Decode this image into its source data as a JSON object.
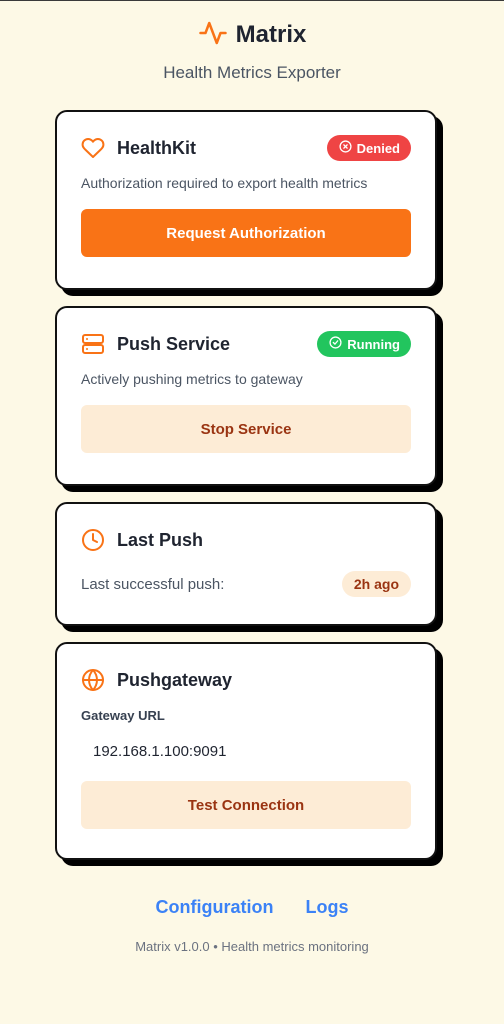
{
  "app": {
    "name": "Matrix",
    "subtitle": "Health Metrics Exporter",
    "logo_icon": "activity-icon",
    "accent_color": "#f97316"
  },
  "healthkit": {
    "title": "HealthKit",
    "icon": "heart-icon",
    "status_label": "Denied",
    "status_icon": "x-circle-icon",
    "status_color": "#ef4444",
    "description": "Authorization required to export health metrics",
    "button_label": "Request Authorization"
  },
  "push_service": {
    "title": "Push Service",
    "icon": "server-icon",
    "status_label": "Running",
    "status_icon": "check-circle-icon",
    "status_color": "#22c55e",
    "description": "Actively pushing metrics to gateway",
    "button_label": "Stop Service"
  },
  "last_push": {
    "title": "Last Push",
    "icon": "clock-icon",
    "label": "Last successful push:",
    "value": "2h ago"
  },
  "pushgateway": {
    "title": "Pushgateway",
    "icon": "globe-icon",
    "field_label": "Gateway URL",
    "url_value": "192.168.1.100:9091",
    "button_label": "Test Connection"
  },
  "footer": {
    "links": [
      "Configuration",
      "Logs"
    ],
    "note": "Matrix v1.0.0 • Health metrics monitoring"
  }
}
